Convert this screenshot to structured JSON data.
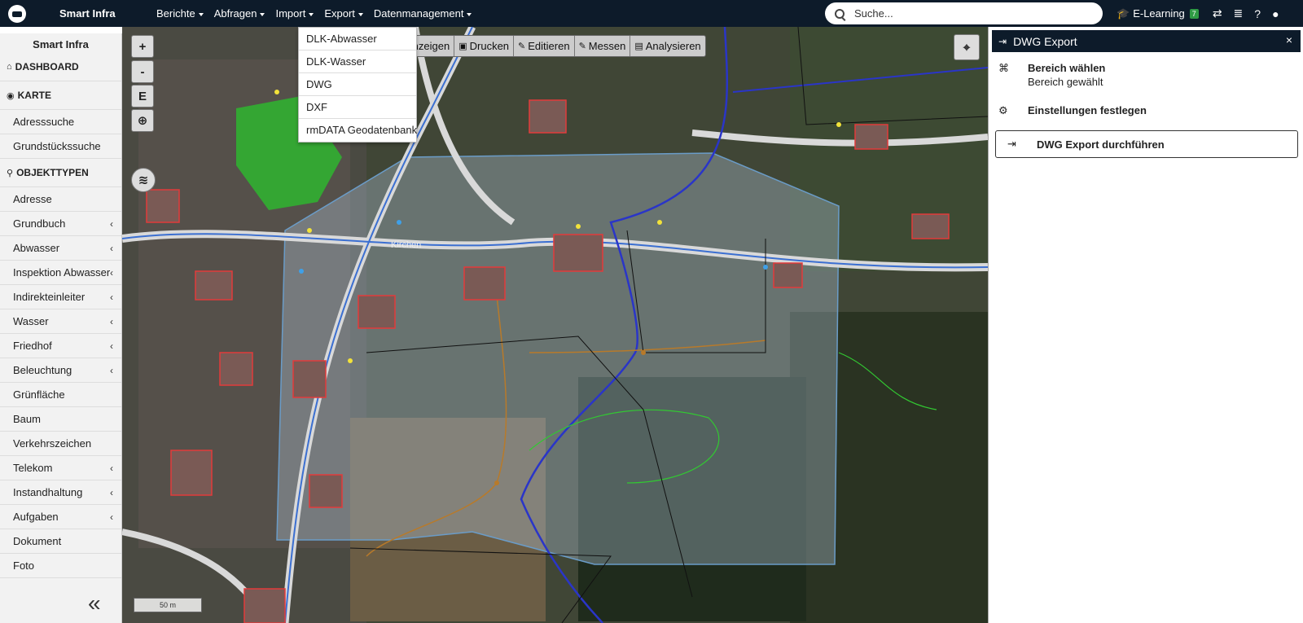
{
  "app": {
    "title": "Smart Infra"
  },
  "nav": [
    {
      "label": "Berichte"
    },
    {
      "label": "Abfragen"
    },
    {
      "label": "Import"
    },
    {
      "label": "Export"
    },
    {
      "label": "Datenmanagement"
    }
  ],
  "search": {
    "placeholder": "Suche..."
  },
  "topright": {
    "elearning_label": "E-Learning",
    "badge": "7"
  },
  "sidebar": {
    "title": "Smart Infra",
    "dashboard": "DASHBOARD",
    "karte": "KARTE",
    "karte_items": [
      "Adresssuche",
      "Grundstückssuche"
    ],
    "objekttypen": "OBJEKTTYPEN",
    "items": [
      {
        "label": "Adresse",
        "chevron": false
      },
      {
        "label": "Grundbuch",
        "chevron": true
      },
      {
        "label": "Abwasser",
        "chevron": true
      },
      {
        "label": "Inspektion Abwasser",
        "chevron": true
      },
      {
        "label": "Indirekteinleiter",
        "chevron": true
      },
      {
        "label": "Wasser",
        "chevron": true
      },
      {
        "label": "Friedhof",
        "chevron": true
      },
      {
        "label": "Beleuchtung",
        "chevron": true
      },
      {
        "label": "Grünfläche",
        "chevron": false
      },
      {
        "label": "Baum",
        "chevron": false
      },
      {
        "label": "Verkehrszeichen",
        "chevron": false
      },
      {
        "label": "Telekom",
        "chevron": true
      },
      {
        "label": "Instandhaltung",
        "chevron": true
      },
      {
        "label": "Aufgaben",
        "chevron": true
      },
      {
        "label": "Dokument",
        "chevron": false
      },
      {
        "label": "Foto",
        "chevron": false
      }
    ]
  },
  "map": {
    "zoom_in": "+",
    "zoom_out": "-",
    "e_button": "E",
    "toolbar": {
      "anzeigen": "Anzeigen",
      "drucken": "Drucken",
      "editieren": "Editieren",
      "messen": "Messen",
      "analysieren": "Analysieren"
    },
    "scale": "50 m",
    "place_label": "Kirchen"
  },
  "export_menu": [
    "DLK-Abwasser",
    "DLK-Wasser",
    "DWG",
    "DXF",
    "rmDATA Geodatenbank"
  ],
  "panel": {
    "title": "DWG Export",
    "close": "×",
    "step1_title": "Bereich wählen",
    "step1_sub": "Bereich gewählt",
    "step2_title": "Einstellungen festlegen",
    "step3_title": "DWG Export durchführen"
  }
}
